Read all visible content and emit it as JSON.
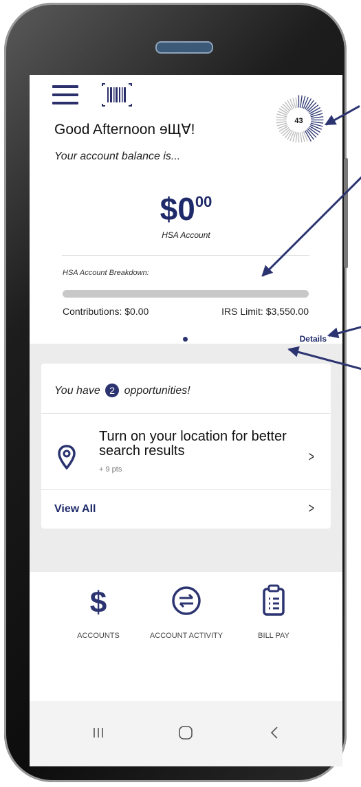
{
  "header": {
    "greeting": "Good Afternoon ɘЩⱯ!",
    "subtitle": "Your account balance is...",
    "score": "43"
  },
  "balance": {
    "dollars": "$0",
    "cents": "00",
    "account_label": "HSA Account"
  },
  "breakdown": {
    "title": "HSA Account Breakdown:",
    "contributions": "Contributions: $0.00",
    "irs_limit": "IRS Limit: $3,550.00",
    "progress": 0,
    "details_link": "Details"
  },
  "opportunities": {
    "prefix": "You have",
    "count": "2",
    "suffix": "opportunities!",
    "item_title": "Turn on your location for better search results",
    "item_points": "+ 9 pts",
    "view_all": "View All"
  },
  "bottom_nav": {
    "items": [
      {
        "label": "ACCOUNTS",
        "icon": "dollar-icon"
      },
      {
        "label": "ACCOUNT ACTIVITY",
        "icon": "transfer-arrows-icon"
      },
      {
        "label": "BILL PAY",
        "icon": "clipboard-icon"
      }
    ]
  },
  "colors": {
    "brand_navy": "#2b3470",
    "background_gray": "#ececec"
  }
}
